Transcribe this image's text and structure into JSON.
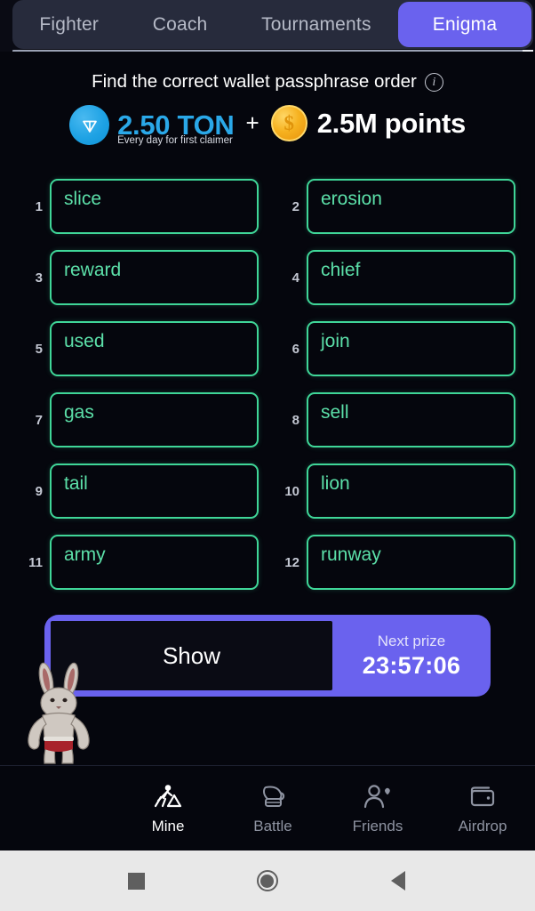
{
  "colors": {
    "accent_purple": "#6A62EE",
    "word_green": "#3fd698",
    "word_text_green": "#5ce0a9",
    "ton_blue": "#2aa8e8",
    "coin_gold": "#f6b11f",
    "page_bg": "#05060d",
    "tabbar_bg": "#272b3c"
  },
  "tabs": [
    {
      "label": "Fighter",
      "active": false
    },
    {
      "label": "Coach",
      "active": false
    },
    {
      "label": "Tournaments",
      "active": false
    },
    {
      "label": "Enigma",
      "active": true
    }
  ],
  "header": {
    "title": "Find the correct wallet passphrase order",
    "info_icon": "info-icon"
  },
  "prize": {
    "ton_icon": "ton-coin-icon",
    "ton_amount": "2.50 TON",
    "ton_subtitle": "Every day for first claimer",
    "separator": "+",
    "points_icon": "dollar-coin-icon",
    "points_amount": "2.5M points"
  },
  "words": [
    {
      "num": "1",
      "word": "slice"
    },
    {
      "num": "2",
      "word": "erosion"
    },
    {
      "num": "3",
      "word": "reward"
    },
    {
      "num": "4",
      "word": "chief"
    },
    {
      "num": "5",
      "word": "used"
    },
    {
      "num": "6",
      "word": "join"
    },
    {
      "num": "7",
      "word": "gas"
    },
    {
      "num": "8",
      "word": "sell"
    },
    {
      "num": "9",
      "word": "tail"
    },
    {
      "num": "10",
      "word": "lion"
    },
    {
      "num": "11",
      "word": "army"
    },
    {
      "num": "12",
      "word": "runway"
    }
  ],
  "action": {
    "show_label": "Show",
    "timer_label": "Next prize",
    "timer_value": "23:57:06"
  },
  "bottom_nav": [
    {
      "label": "Mine",
      "icon": "miner-pickaxe-icon",
      "active": true
    },
    {
      "label": "Battle",
      "icon": "boxing-glove-icon",
      "active": false
    },
    {
      "label": "Friends",
      "icon": "person-heart-icon",
      "active": false
    },
    {
      "label": "Airdrop",
      "icon": "wallet-icon",
      "active": false
    }
  ],
  "android_nav": [
    {
      "icon": "recents-square-icon"
    },
    {
      "icon": "home-circle-icon"
    },
    {
      "icon": "back-triangle-icon"
    }
  ]
}
